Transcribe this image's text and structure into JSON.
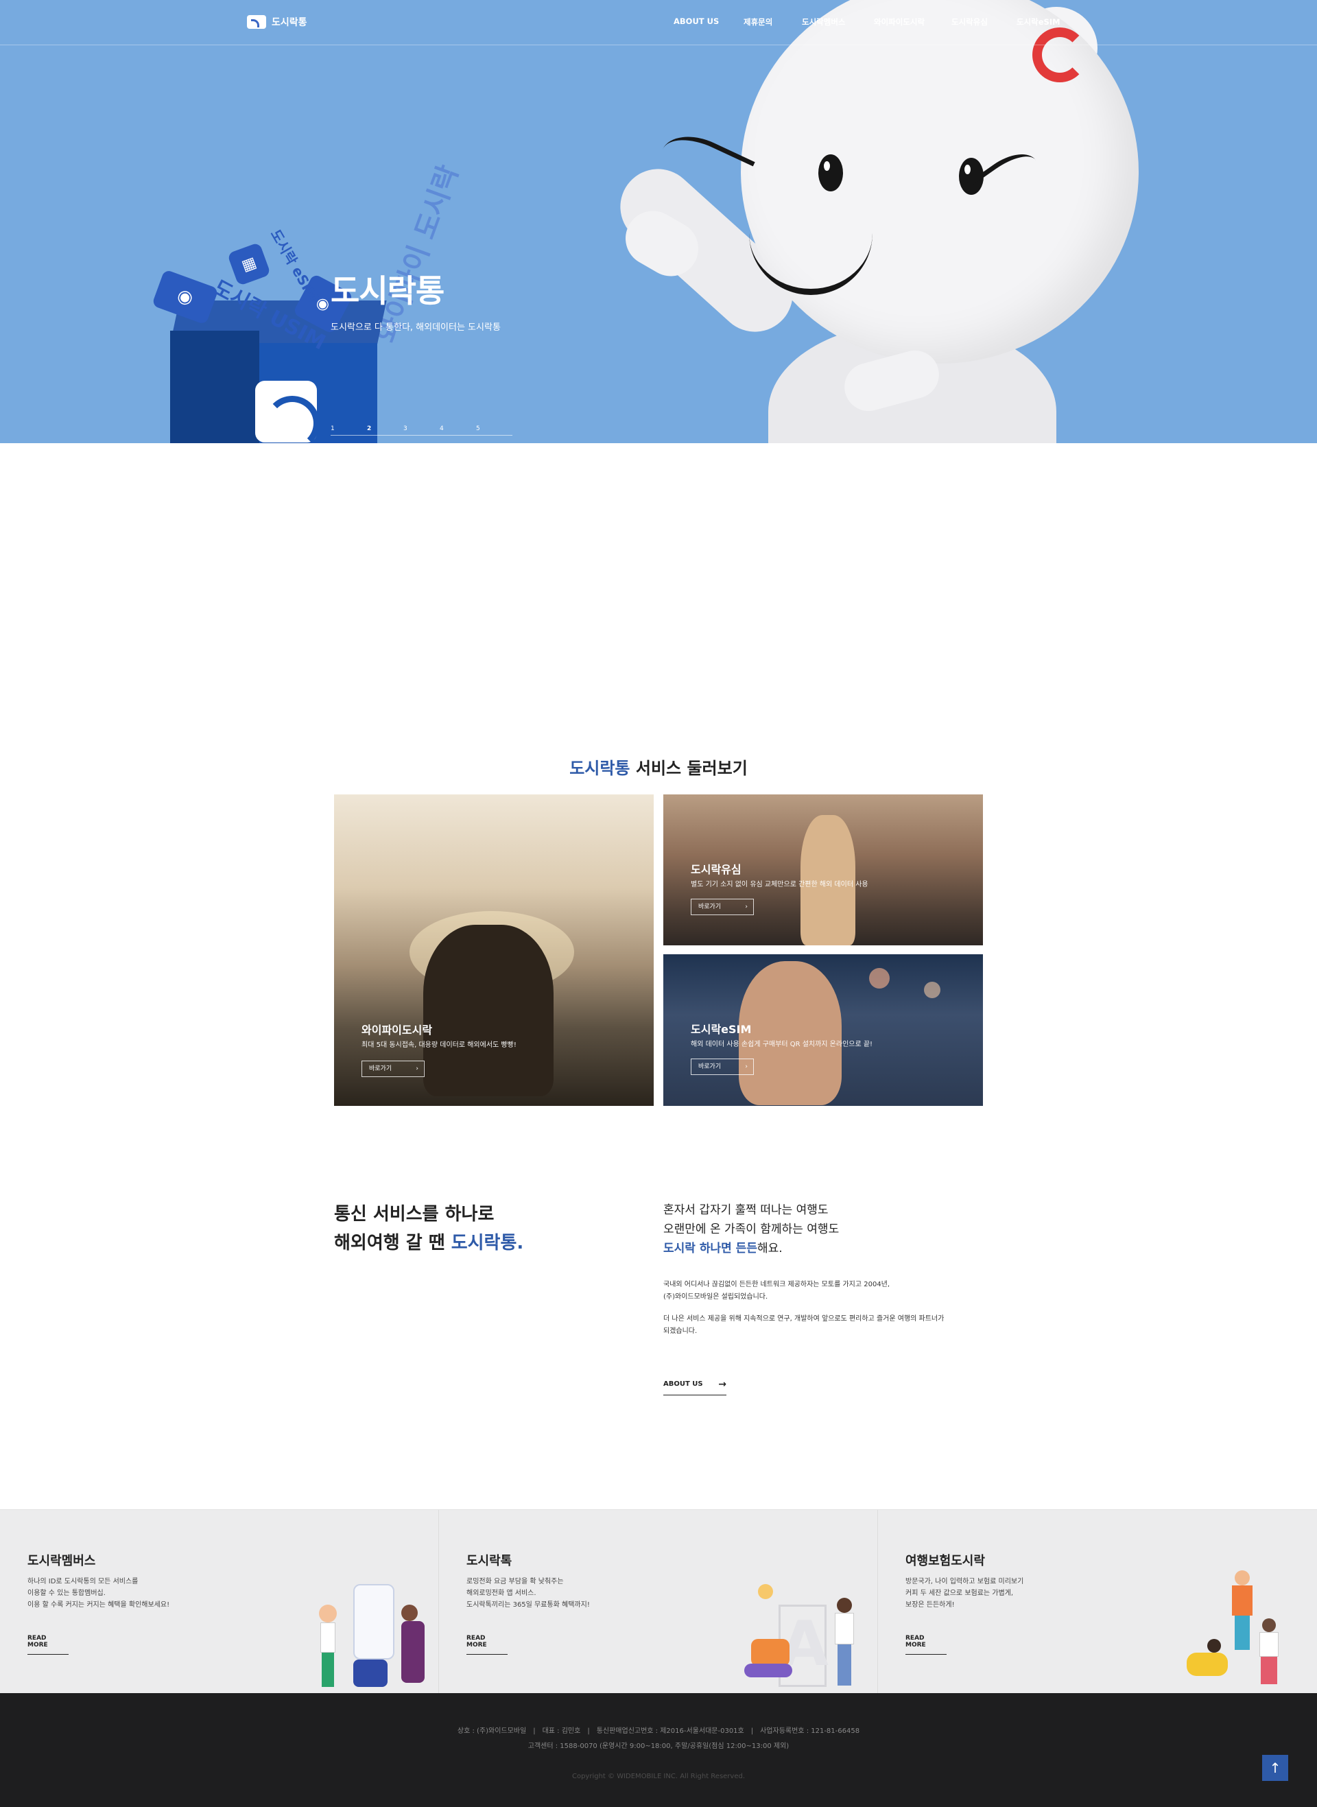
{
  "header": {
    "logo_text": "도시락통",
    "nav": [
      "ABOUT US",
      "제휴문의",
      "도시락멤버스",
      "와이파이도시락",
      "도시락유심",
      "도시락eSIM"
    ]
  },
  "hero": {
    "title": "도시락통",
    "subtitle": "도시락으로 다 통한다, 해외데이터는 도시락통",
    "slides": [
      "1",
      "2",
      "3",
      "4",
      "5"
    ],
    "box_labels": {
      "usim": "도시락 USIM",
      "esim": "도시락 eSIM",
      "wifi": "와이파이 도시락"
    }
  },
  "services": {
    "title_highlight": "도시락통",
    "title_rest": " 서비스 둘러보기",
    "tiles": [
      {
        "title": "와이파이도시락",
        "desc": "최대 5대 동시접속, 대용량 데이터로 해외에서도 빵빵!",
        "button": "바로가기"
      },
      {
        "title": "도시락유심",
        "desc": "별도 기기 소지 없이 유심 교체만으로 간편한 해외 데이터 사용",
        "button": "바로가기"
      },
      {
        "title": "도시락eSIM",
        "desc": "해외 데이터 사용 손쉽게 구매부터 QR 설치까지 온라인으로 끝!",
        "button": "바로가기"
      }
    ]
  },
  "about": {
    "heading_line1": "통신 서비스를 하나로",
    "heading_line2_prefix": "해외여행 갈 땐 ",
    "heading_line2_highlight": "도시락통.",
    "lead_line1": "혼자서 갑자기 훌쩍 떠나는 여행도",
    "lead_line2": "오랜만에 온 가족이 함께하는 여행도",
    "lead_line3_highlight": "도시락 하나면 든든",
    "lead_line3_suffix": "해요.",
    "para1_line1": "국내외 어디서나 끊김없이 든든한 네트워크 제공하자는 모토를 가지고 2004년,",
    "para1_line2": "(주)와이드모바일은 설립되었습니다.",
    "para2_line1": "더 나은 서비스 제공을 위해 지속적으로 연구, 개발하여 앞으로도 편리하고 즐거운 여행의 파트너가",
    "para2_line2": "되겠습니다.",
    "button": "ABOUT US"
  },
  "panels": [
    {
      "title": "도시락멤버스",
      "lines": [
        "하나의 ID로 도시락통의 모든 서비스를",
        "이용할 수 있는 통합멤버십.",
        "이용 할 수록 커지는 커지는 혜택을 확인해보세요!"
      ],
      "button": "READ MORE"
    },
    {
      "title": "도시락톡",
      "lines": [
        "로밍전화 요금 부담을 확 낮춰주는",
        "해외로밍전화 앱 서비스.",
        "도시락톡끼리는 365일 무료통화 혜택까지!"
      ],
      "button": "READ MORE"
    },
    {
      "title": "여행보험도시락",
      "lines": [
        "방문국가, 나이 입력하고 보험료 미리보기",
        "커피 두 세잔 값으로 보험료는 가볍게,",
        "보장은 든든하게!"
      ],
      "button": "READ MORE"
    }
  ],
  "footer": {
    "line1": "상호 : (주)와이드모바일　|　대표 : 김민호　|　통신판매업신고번호 : 제2016-서울서대문-0301호　|　사업자등록번호 : 121-81-66458",
    "line2": "고객센터 : 1588-0070 (운영시간 9:00~18:00, 주말/공휴일(점심 12:00~13:00 제외)",
    "copyright": "Copyright © WIDEMOBILE INC. All Right Reserved.",
    "top_button": "↑"
  }
}
